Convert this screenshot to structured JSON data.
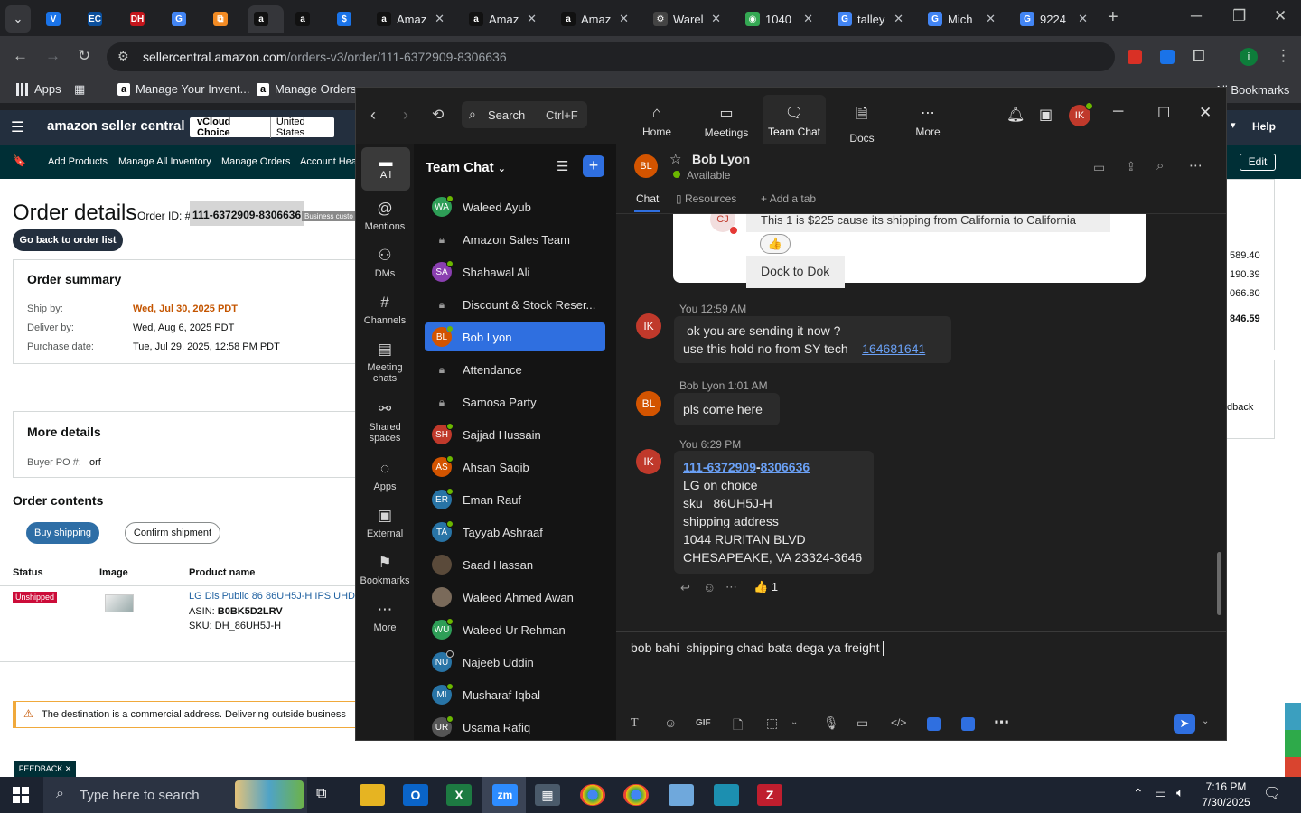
{
  "browser": {
    "tabs": [
      {
        "label": "",
        "fav": "V",
        "color": "#1a73e8"
      },
      {
        "label": "",
        "fav": "EC",
        "color": "#0b4f9c"
      },
      {
        "label": "",
        "fav": "DH",
        "color": "#c4161c"
      },
      {
        "label": "",
        "fav": "G",
        "color": "#4285f4"
      },
      {
        "label": "",
        "fav": "⧉",
        "color": "#f28b24"
      },
      {
        "label": "",
        "fav": "a",
        "color": "#111111"
      },
      {
        "label": "",
        "fav": "a",
        "color": "#111111"
      },
      {
        "label": "",
        "fav": "$",
        "color": "#1a73e8"
      },
      {
        "label": "Amaz",
        "fav": "a",
        "color": "#111111"
      },
      {
        "label": "Amaz",
        "fav": "a",
        "color": "#111111"
      },
      {
        "label": "Amaz",
        "fav": "a",
        "color": "#111111"
      },
      {
        "label": "Warel",
        "fav": "⚙",
        "color": "#444444"
      },
      {
        "label": "1040",
        "fav": "◉",
        "color": "#34a853"
      },
      {
        "label": "talley",
        "fav": "G",
        "color": "#4285f4"
      },
      {
        "label": "Mich",
        "fav": "G",
        "color": "#4285f4"
      },
      {
        "label": "9224",
        "fav": "G",
        "color": "#4285f4"
      }
    ],
    "url_host": "sellercentral.amazon.com",
    "url_path": "/orders-v3/order/111-6372909-8306636",
    "bookmarks": {
      "apps": "Apps",
      "b1": "Manage Your Invent...",
      "b2": "Manage Orders",
      "all": "All Bookmarks"
    }
  },
  "amazon": {
    "logo": "amazon seller central",
    "account_store": "vCloud Choice",
    "account_region": "United States",
    "help": "Help",
    "nav": [
      "Add Products",
      "Manage All Inventory",
      "Manage Orders",
      "Account Heal"
    ],
    "edit": "Edit",
    "page_title": "Order details",
    "order_id_label": "Order ID: #",
    "order_id": "111-6372909-8306636",
    "business_badge": "Business custo",
    "back_button": "Go back to order list",
    "summary": {
      "title": "Order summary",
      "ship_by_label": "Ship by:",
      "ship_by": "Wed, Jul 30, 2025 PDT",
      "deliver_by_label": "Deliver by:",
      "deliver_by": "Wed, Aug 6, 2025 PDT",
      "purchase_label": "Purchase date:",
      "purchase": "Tue, Jul 29, 2025, 12:58 PM PDT"
    },
    "right_values": [
      "589.40",
      "190.39",
      "066.80",
      "846.59"
    ],
    "feedback_text": "dback",
    "more_details": {
      "title": "More details",
      "po_label": "Buyer PO #:",
      "po": "orf"
    },
    "contents_title": "Order contents",
    "buy_shipping": "Buy shipping",
    "confirm_shipment": "Confirm shipment",
    "table": {
      "headers": [
        "Status",
        "Image",
        "Product name"
      ],
      "status": "Unshipped",
      "product": "LG Dis Public 86 86UH5J-H IPS UHD",
      "asin_label": "ASIN:",
      "asin": "B0BK5D2LRV",
      "sku_label": "SKU:",
      "sku": "DH_86UH5J-H"
    },
    "warning": "The destination is a commercial address. Delivering outside business",
    "feedback_tab": "FEEDBACK"
  },
  "teams": {
    "search_label": "Search",
    "search_shortcut": "Ctrl+F",
    "topnav": [
      "Home",
      "Meetings",
      "Team Chat",
      "Docs",
      "More"
    ],
    "user_initials": "IK",
    "rail": [
      "All",
      "Mentions",
      "DMs",
      "Channels",
      "Meeting chats",
      "Shared spaces",
      "Apps",
      "External",
      "Bookmarks",
      "More"
    ],
    "chatlist_title": "Team Chat",
    "contacts": [
      {
        "name": "Waleed Ayub",
        "initials": "WA",
        "color": "#2e9e57",
        "type": "avatar"
      },
      {
        "name": "Amazon Sales Team",
        "initials": "",
        "color": "",
        "type": "lock"
      },
      {
        "name": "Shahawal Ali",
        "initials": "SA",
        "color": "#8a3fb0",
        "type": "avatar"
      },
      {
        "name": "Discount & Stock Reser...",
        "initials": "",
        "color": "",
        "type": "lock"
      },
      {
        "name": "Bob Lyon",
        "initials": "BL",
        "color": "#d35400",
        "type": "avatar"
      },
      {
        "name": "Attendance",
        "initials": "",
        "color": "",
        "type": "lock"
      },
      {
        "name": "Samosa Party",
        "initials": "",
        "color": "",
        "type": "lock"
      },
      {
        "name": "Sajjad Hussain",
        "initials": "SH",
        "color": "#c0392b",
        "type": "avatar"
      },
      {
        "name": "Ahsan Saqib",
        "initials": "AS",
        "color": "#d35400",
        "type": "avatar"
      },
      {
        "name": "Eman Rauf",
        "initials": "ER",
        "color": "#2874a6",
        "type": "avatar"
      },
      {
        "name": "Tayyab Ashraaf",
        "initials": "TA",
        "color": "#2874a6",
        "type": "avatar"
      },
      {
        "name": "Saad Hassan",
        "initials": "",
        "color": "#5a4a3a",
        "type": "photo"
      },
      {
        "name": "Waleed Ahmed Awan",
        "initials": "",
        "color": "#7a6a5a",
        "type": "photo"
      },
      {
        "name": "Waleed Ur Rehman",
        "initials": "WU",
        "color": "#2e9e57",
        "type": "avatar"
      },
      {
        "name": "Najeeb Uddin",
        "initials": "NU",
        "color": "#2874a6",
        "type": "avatar"
      },
      {
        "name": "Musharaf Iqbal",
        "initials": "MI",
        "color": "#2874a6",
        "type": "avatar"
      },
      {
        "name": "Usama Rafiq",
        "initials": "UR",
        "color": "#555555",
        "type": "avatar"
      }
    ],
    "chat": {
      "name": "Bob Lyon",
      "initials": "BL",
      "status": "Available",
      "tabs": [
        "Chat",
        "Resources",
        "Add a tab"
      ],
      "quoted_avatar": "CJ",
      "quoted_text": "This 1 is $225 cause its shipping from California to California",
      "quoted_reaction": "👍",
      "quoted_reply": "Dock to Dok",
      "messages": [
        {
          "meta": "You 12:59 AM",
          "initials": "IK",
          "line1": "ok  you are sending it now ?",
          "line2": "use this  hold no from SY tech",
          "link": "164681641"
        },
        {
          "meta": "Bob Lyon 1:01 AM",
          "initials": "BL",
          "text": "pls come here"
        },
        {
          "meta": "You 6:29 PM",
          "initials": "IK",
          "link1": "111-6372909",
          "sep": "-",
          "link2": "8306636",
          "lines": [
            "LG on choice",
            "sku   86UH5J-H",
            "shipping address",
            "1044 RURITAN BLVD",
            "CHESAPEAKE, VA 23324-3646"
          ],
          "reaction": "👍",
          "reaction_count": "1"
        }
      ],
      "composer_text": "bob bahi  shipping chad bata dega ya freight "
    }
  },
  "taskbar": {
    "search_placeholder": "Type here to search",
    "time": "7:16 PM",
    "date": "7/30/2025"
  },
  "colors": {
    "teams_accent": "#2f6fe0",
    "amazon_orange": "#c45500",
    "status_unshipped": "#cc0c39"
  }
}
